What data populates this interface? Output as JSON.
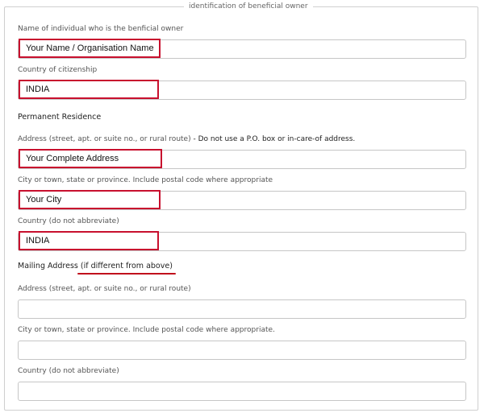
{
  "legend": "identification of beneficial owner",
  "fields": {
    "name_label": "Name of individual who is the benficial owner",
    "name_value": "Your Name / Organisation Name",
    "citizenship_label": "Country of citizenship",
    "citizenship_value": "INDIA",
    "permanent_residence_title": "Permanent Residence",
    "address_label": "Address (street, apt. or suite no., or rural route)",
    "address_note": " - Do not use a P.O. box or in-care-of address.",
    "address_value": "Your Complete Address",
    "city_label": "City or town, state or province. Include postal code where appropriate",
    "city_value": "Your City",
    "country_label": "Country (do not abbreviate)",
    "country_value": "INDIA"
  },
  "mailing": {
    "title": "Mailing Address ",
    "title_note": "(if different from above)",
    "address_label": "Address (street, apt. or suite no., or rural route)",
    "address_value": "",
    "city_label": "City or town, state or province. Include postal code where appropriate.",
    "city_value": "",
    "country_label": "Country (do not abbreviate)",
    "country_value": ""
  },
  "colors": {
    "highlight": "#c8102e",
    "border": "#c6c6c6"
  }
}
